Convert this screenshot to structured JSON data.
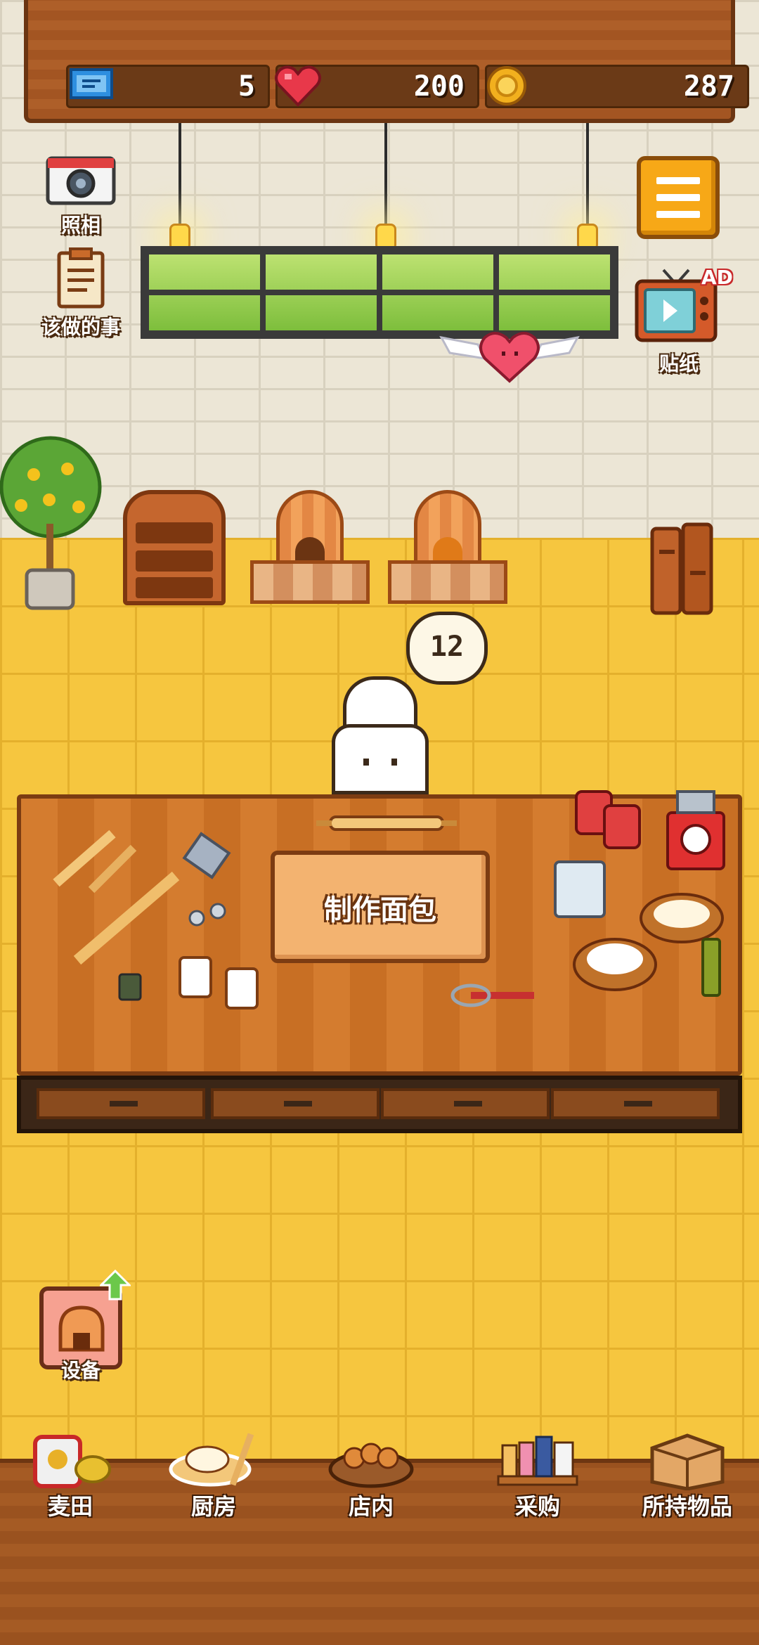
{
  "stats": {
    "tickets": "5",
    "hearts": "200",
    "coins": "287"
  },
  "side_buttons": {
    "camera_label": "照相",
    "todo_label": "该做的事",
    "sticker_label": "贴纸",
    "ad_badge": "AD",
    "menu_icon": "hamburger-menu-icon"
  },
  "oven_timer": "12",
  "table": {
    "make_bread_label": "制作面包"
  },
  "equipment_button": {
    "label": "设备"
  },
  "bottom_nav": {
    "wheat_field": "麦田",
    "kitchen": "厨房",
    "shop": "店内",
    "purchase": "采购",
    "inventory": "所持物品"
  },
  "colors": {
    "wall": "#ece6d6",
    "floor": "#f6c63f",
    "wood": "#a35522",
    "menu_button": "#f7a817",
    "heart": "#e8384a",
    "coin": "#f2b01e"
  }
}
